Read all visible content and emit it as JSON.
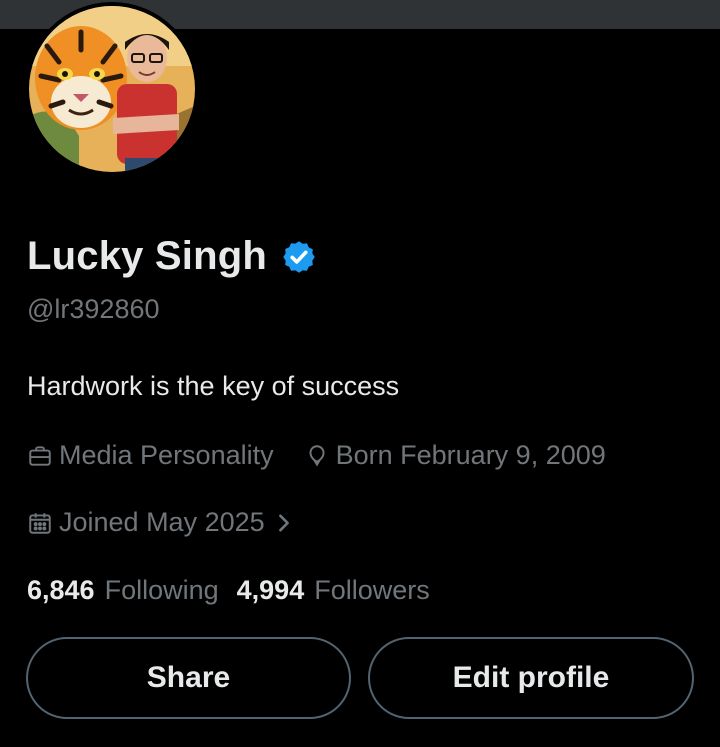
{
  "profile": {
    "name": "Lucky Singh",
    "handle": "@lr392860",
    "bio": "Hardwork is the key of success",
    "verified": true,
    "category": "Media Personality",
    "born": "Born February 9, 2009",
    "joined": "Joined May 2025"
  },
  "stats": {
    "following_count": "6,846",
    "following_label": "Following",
    "followers_count": "4,994",
    "followers_label": "Followers"
  },
  "buttons": {
    "share": "Share",
    "edit_profile": "Edit profile"
  },
  "icons": {
    "verified": "verified-badge-icon",
    "category": "briefcase-icon",
    "born": "balloon-icon",
    "joined": "calendar-icon",
    "chevron": "chevron-right-icon"
  },
  "colors": {
    "background": "#000000",
    "text": "#e7e9ea",
    "muted": "#71767b",
    "verified": "#1d9bf0",
    "border": "#536471"
  }
}
